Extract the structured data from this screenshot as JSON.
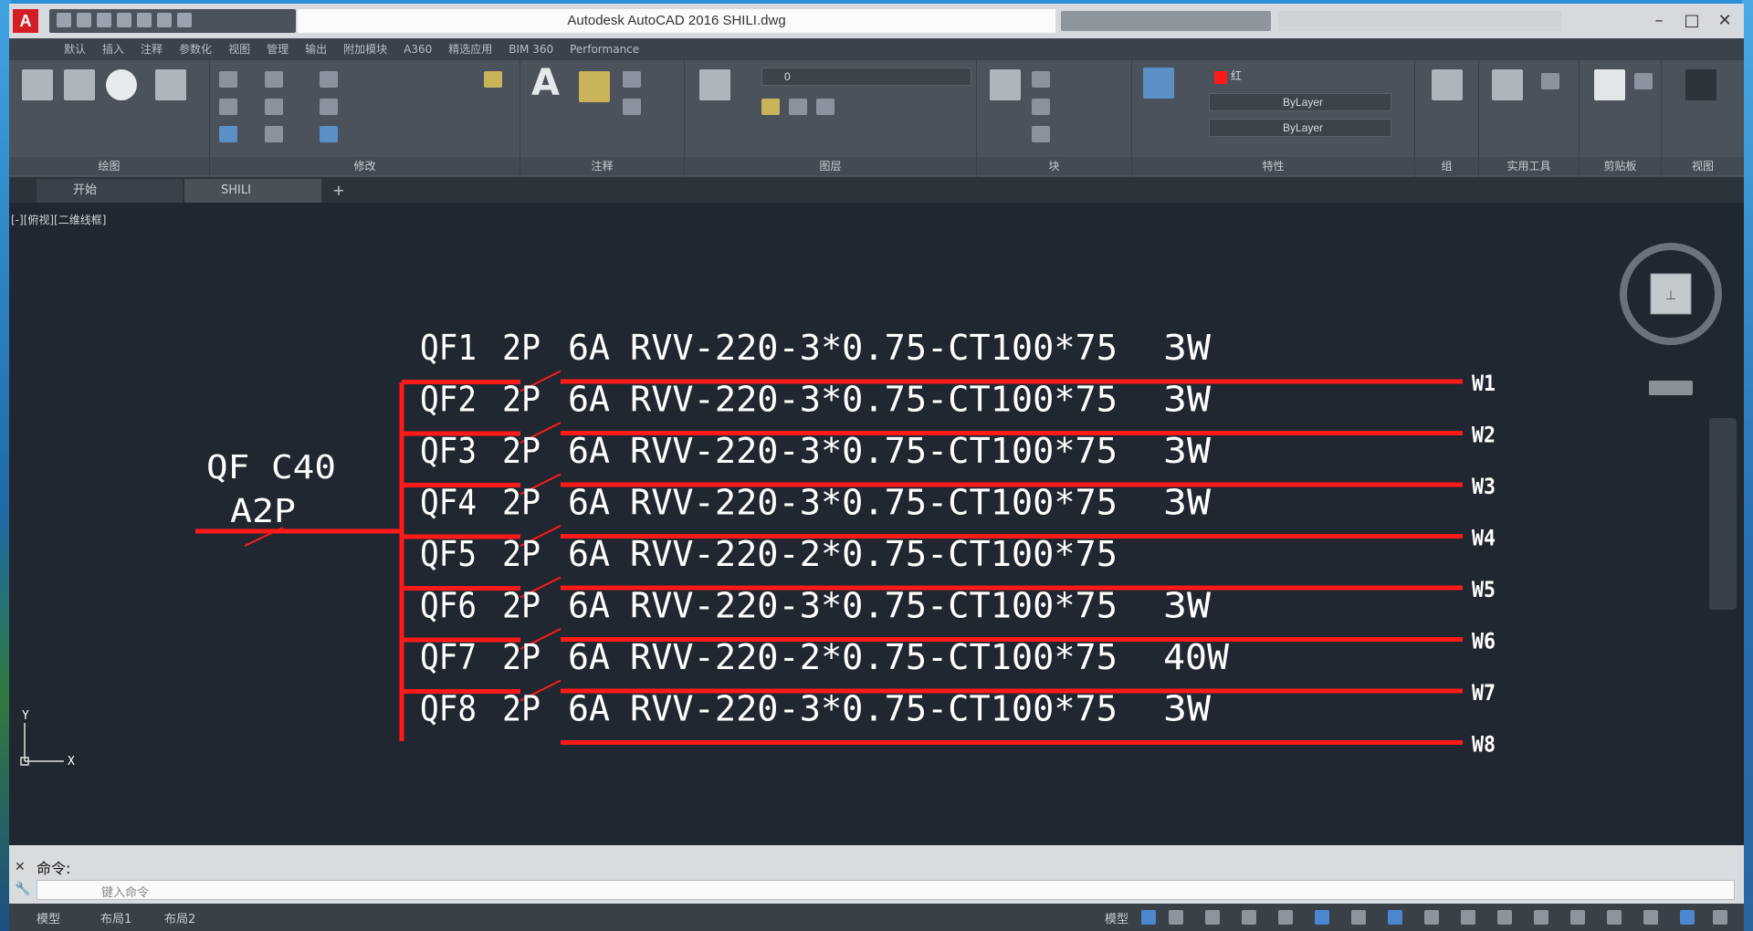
{
  "window": {
    "title": "Autodesk AutoCAD 2016     SHILI.dwg",
    "logo_letter": "A"
  },
  "ribbon": {
    "tabs": [
      "默认",
      "插入",
      "注释",
      "参数化",
      "视图",
      "管理",
      "输出",
      "附加模块",
      "A360",
      "精选应用",
      "BIM 360",
      "Performance"
    ],
    "panels": {
      "draw": "绘图",
      "modify": "修改",
      "annotation": "注释",
      "layers": "图层",
      "block": "块",
      "properties": "特性",
      "groups": "组",
      "utilities": "实用工具",
      "clipboard": "剪贴板",
      "view": "视图"
    },
    "layer_value": "0",
    "color_value": "红",
    "linetype_value": "ByLayer",
    "lineweight_value": "ByLayer"
  },
  "doc_tabs": {
    "start": "开始",
    "file": "SHILI",
    "add": "+"
  },
  "viewport": {
    "label": "[-][俯视][二维线框]",
    "axis_y": "Y",
    "axis_x": "X"
  },
  "drawing": {
    "main_breaker_line1": "QF C40",
    "main_breaker_line2": "A2P",
    "circuits": [
      {
        "breaker": "QF1",
        "poles": "2P",
        "rating": "6A",
        "cable": "RVV-220-3*0.75-CT100*75",
        "load": "3W",
        "label": "W1"
      },
      {
        "breaker": "QF2",
        "poles": "2P",
        "rating": "6A",
        "cable": "RVV-220-3*0.75-CT100*75",
        "load": "3W",
        "label": "W2"
      },
      {
        "breaker": "QF3",
        "poles": "2P",
        "rating": "6A",
        "cable": "RVV-220-3*0.75-CT100*75",
        "load": "3W",
        "label": "W3"
      },
      {
        "breaker": "QF4",
        "poles": "2P",
        "rating": "6A",
        "cable": "RVV-220-3*0.75-CT100*75",
        "load": "3W",
        "label": "W4"
      },
      {
        "breaker": "QF5",
        "poles": "2P",
        "rating": "6A",
        "cable": "RVV-220-2*0.75-CT100*75",
        "load": "",
        "label": "W5"
      },
      {
        "breaker": "QF6",
        "poles": "2P",
        "rating": "6A",
        "cable": "RVV-220-3*0.75-CT100*75",
        "load": "3W",
        "label": "W6"
      },
      {
        "breaker": "QF7",
        "poles": "2P",
        "rating": "6A",
        "cable": "RVV-220-2*0.75-CT100*75",
        "load": "40W",
        "label": "W7"
      },
      {
        "breaker": "QF8",
        "poles": "2P",
        "rating": "6A",
        "cable": "RVV-220-3*0.75-CT100*75",
        "load": "3W",
        "label": "W8"
      }
    ],
    "line_color": "#ff1a1a",
    "text_color": "#ffffff"
  },
  "command": {
    "history": "命令:",
    "placeholder": "键入命令"
  },
  "statusbar": {
    "model_tab": "模型",
    "layout1": "布局1",
    "layout2": "布局2",
    "model_space": "模型"
  },
  "colors": {
    "canvas_bg": "#212730",
    "ribbon_bg": "#4b525c",
    "accent_red": "#d21f25"
  }
}
